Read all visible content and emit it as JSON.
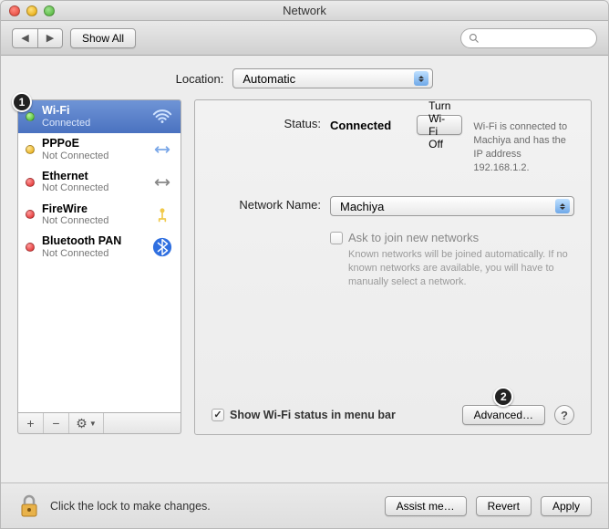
{
  "window": {
    "title": "Network"
  },
  "toolbar": {
    "show_all": "Show All",
    "search_placeholder": ""
  },
  "annotations": {
    "step1": "1",
    "step2": "2"
  },
  "location": {
    "label": "Location:",
    "value": "Automatic"
  },
  "sidebar": {
    "items": [
      {
        "name": "Wi-Fi",
        "status": "Connected",
        "dot": "green",
        "selected": true,
        "icon": "wifi"
      },
      {
        "name": "PPPoE",
        "status": "Not Connected",
        "dot": "yellow",
        "selected": false,
        "icon": "pppoe"
      },
      {
        "name": "Ethernet",
        "status": "Not Connected",
        "dot": "red",
        "selected": false,
        "icon": "ethernet"
      },
      {
        "name": "FireWire",
        "status": "Not Connected",
        "dot": "red",
        "selected": false,
        "icon": "firewire"
      },
      {
        "name": "Bluetooth PAN",
        "status": "Not Connected",
        "dot": "red",
        "selected": false,
        "icon": "bluetooth"
      }
    ],
    "add": "+",
    "remove": "−",
    "action": "⚙▾"
  },
  "detail": {
    "status_label": "Status:",
    "status_value": "Connected",
    "turn_off": "Turn Wi-Fi Off",
    "status_help": "Wi-Fi is connected to Machiya and has the IP address 192.168.1.2.",
    "network_label": "Network Name:",
    "network_value": "Machiya",
    "ask_label": "Ask to join new networks",
    "ask_help": "Known networks will be joined automatically. If no known networks are available, you will have to manually select a network.",
    "show_menubar": "Show Wi-Fi status in menu bar",
    "advanced": "Advanced…",
    "help": "?"
  },
  "footer": {
    "lock_text": "Click the lock to make changes.",
    "assist": "Assist me…",
    "revert": "Revert",
    "apply": "Apply"
  }
}
